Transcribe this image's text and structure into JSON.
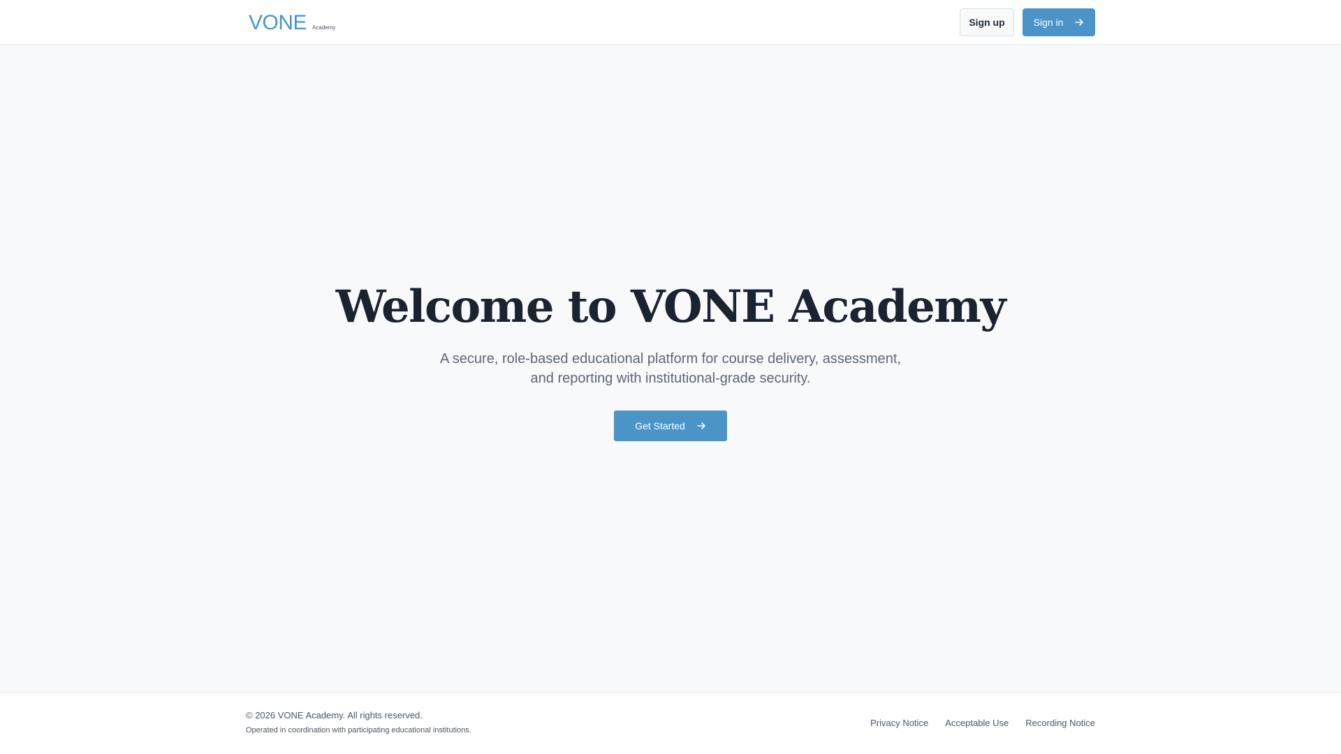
{
  "header": {
    "logo_word": "VONE",
    "logo_sub": "Academy",
    "signup_label": "Sign up",
    "signin_label": "Sign in"
  },
  "hero": {
    "title": "Welcome to VONE Academy",
    "subtitle": "A secure, role-based educational platform for course delivery, assessment, and reporting with institutional-grade security.",
    "cta_label": "Get Started"
  },
  "footer": {
    "copyright": "© 2026 VONE Academy. All rights reserved.",
    "operated": "Operated in coordination with participating educational institutions.",
    "links": [
      "Privacy Notice",
      "Acceptable Use",
      "Recording Notice"
    ]
  },
  "colors": {
    "accent": "#4b94c7",
    "background": "#f8f9fb",
    "title": "#1a2330"
  },
  "icons": {
    "signin": "arrow-right-icon",
    "cta": "arrow-right-icon"
  }
}
